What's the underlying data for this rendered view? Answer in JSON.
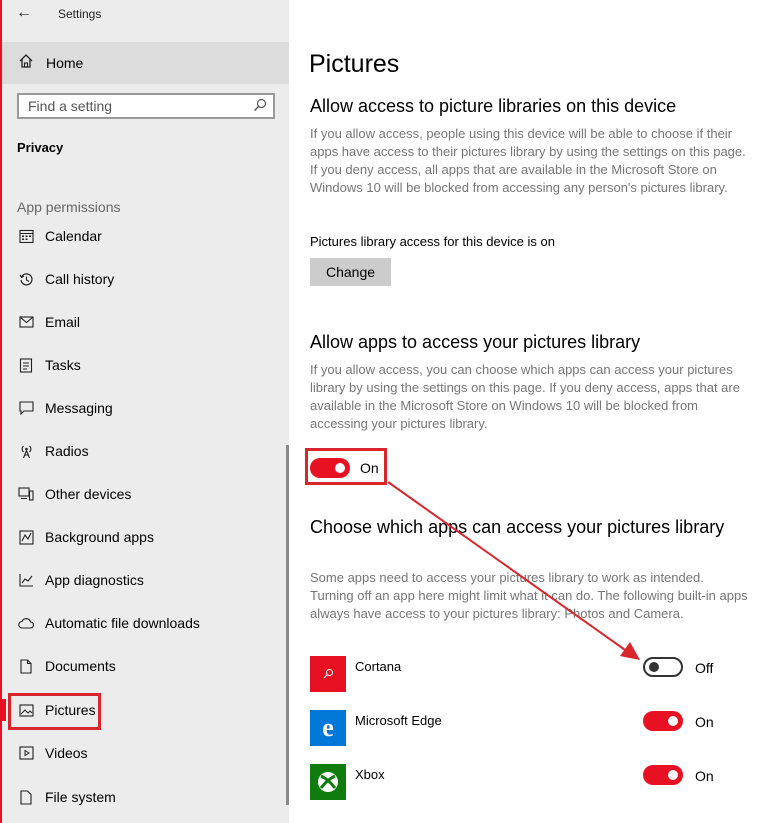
{
  "window": {
    "title": "Settings"
  },
  "sidebar": {
    "home_label": "Home",
    "search_placeholder": "Find a setting",
    "section_title": "Privacy",
    "group_header": "App permissions",
    "items": [
      {
        "label": "Calendar",
        "icon": "calendar-icon"
      },
      {
        "label": "Call history",
        "icon": "history-icon"
      },
      {
        "label": "Email",
        "icon": "mail-icon"
      },
      {
        "label": "Tasks",
        "icon": "tasks-icon"
      },
      {
        "label": "Messaging",
        "icon": "message-icon"
      },
      {
        "label": "Radios",
        "icon": "antenna-icon"
      },
      {
        "label": "Other devices",
        "icon": "devices-icon"
      },
      {
        "label": "Background apps",
        "icon": "background-apps-icon"
      },
      {
        "label": "App diagnostics",
        "icon": "diagnostics-icon"
      },
      {
        "label": "Automatic file downloads",
        "icon": "cloud-icon"
      },
      {
        "label": "Documents",
        "icon": "document-icon"
      },
      {
        "label": "Pictures",
        "icon": "picture-icon",
        "selected": true
      },
      {
        "label": "Videos",
        "icon": "video-icon"
      },
      {
        "label": "File system",
        "icon": "file-icon"
      }
    ]
  },
  "main": {
    "title": "Pictures",
    "device_section": {
      "heading": "Allow access to picture libraries on this device",
      "description": "If you allow access, people using this device will be able to choose if their apps have access to their pictures library by using the settings on this page. If you deny access, all apps that are available in the Microsoft Store on Windows 10 will be blocked from accessing any person's pictures library.",
      "status": "Pictures library access for this device is on",
      "button_label": "Change"
    },
    "apps_section": {
      "heading": "Allow apps to access your pictures library",
      "description": "If you allow access, you can choose which apps can access your pictures library by using the settings on this page. If you deny access, apps that are available in the Microsoft Store on Windows 10 will be blocked from accessing your pictures library.",
      "toggle_state": "On"
    },
    "choose_section": {
      "heading": "Choose which apps can access your pictures library",
      "description": "Some apps need to access your pictures library to work as intended. Turning off an app here might limit what it can do. The following built-in apps always have access to your pictures library: Photos and Camera.",
      "apps": [
        {
          "name": "Cortana",
          "state": "Off",
          "icon": "cortana-icon",
          "color": "#e81123"
        },
        {
          "name": "Microsoft Edge",
          "state": "On",
          "icon": "edge-icon",
          "color": "#0078d7"
        },
        {
          "name": "Xbox",
          "state": "On",
          "icon": "xbox-icon",
          "color": "#107c10"
        }
      ]
    }
  },
  "colors": {
    "accent": "#e81123",
    "annotation": "#d9262c"
  }
}
